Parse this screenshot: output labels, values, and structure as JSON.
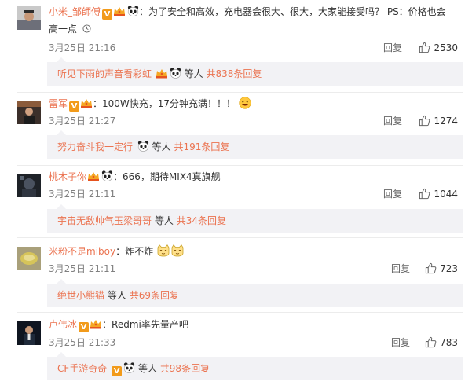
{
  "comments": [
    {
      "username": "小米_邹師傅",
      "content_line1": "：为了安全和高效，充电器会很大、很大，大家能接受吗？ PS：价格也会",
      "content_line2": "高一点",
      "time": "3月25日 21:16",
      "reply_label": "回复",
      "likes": "2530",
      "sub_user": "听见下雨的声音看彩虹",
      "sub_mid": "等人",
      "sub_count": "共838条回复"
    },
    {
      "username": "雷军",
      "content": "：100W快充，17分钟充满！！！",
      "time": "3月25日 21:27",
      "reply_label": "回复",
      "likes": "1274",
      "sub_user": "努力奋斗我一定行",
      "sub_mid": "等人",
      "sub_count": "共191条回复"
    },
    {
      "username": "桃木子你",
      "content": "：666，期待MIX4真旗舰",
      "time": "3月25日 21:11",
      "reply_label": "回复",
      "likes": "1044",
      "sub_user": "宇宙无敌帅气玉梁哥哥",
      "sub_mid": "等人",
      "sub_count": "共34条回复"
    },
    {
      "username": "米粉不是miboy",
      "content": "：炸不炸",
      "time": "3月25日 21:11",
      "reply_label": "回复",
      "likes": "723",
      "sub_user": "绝世小熊猫",
      "sub_mid": "等人",
      "sub_count": "共69条回复"
    },
    {
      "username": "卢伟冰",
      "content": "：Redmi率先量产吧",
      "time": "3月25日 21:33",
      "reply_label": "回复",
      "likes": "783",
      "sub_user": "CF手游奇奇",
      "sub_mid": "等人",
      "sub_count": "共98条回复"
    }
  ],
  "colors": {
    "username": "#eb7350",
    "subreply_bg": "#f2f2f5",
    "verified_badge": "#f29b1b",
    "meta_text": "#808080"
  },
  "icons": [
    "verified-v-icon",
    "vip-crown-icon",
    "panda-emoji-icon",
    "grin-emoji-icon",
    "cat-emoji-icon",
    "clock-icon",
    "thumb-up-icon"
  ]
}
